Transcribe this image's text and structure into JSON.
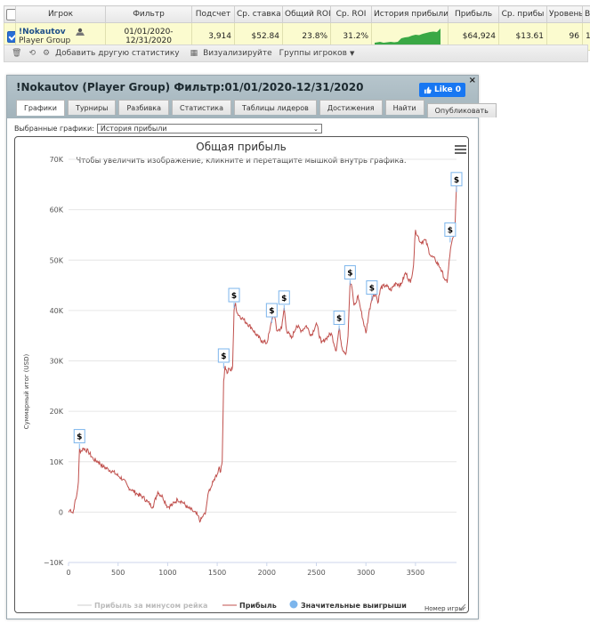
{
  "table": {
    "headers": [
      "Игрок",
      "Фильтр",
      "Подсчет",
      "Ср. ставка",
      "Общий ROI",
      "Ср. ROI",
      "История прибыли",
      "Прибыль",
      "Ср. прибы",
      "Уровень",
      "В"
    ],
    "row": {
      "player_name": "!Nokautov",
      "player_group": "Player Group",
      "filter_line1": "01/01/2020-",
      "filter_line2": "12/31/2020",
      "count": "3,914",
      "avg_stake": "$52.84",
      "total_roi": "23.8%",
      "avg_roi": "31.2%",
      "profit": "$64,924",
      "avg_profit": "$13.61",
      "level": "96",
      "extra": "1"
    }
  },
  "toolbar": {
    "add_stat": "Добавить другую статистику",
    "visualize": "Визуализируйте",
    "player_groups": "Группы игроков"
  },
  "dialog": {
    "title": "!Nokautov (Player Group) Фильтр:01/01/2020-12/31/2020",
    "like_label": "Like 0",
    "close": "×",
    "tabs": [
      "Графики",
      "Турниры",
      "Разбивка",
      "Статистика",
      "Таблицы лидеров",
      "Достижения",
      "Найти",
      "Опубликовать"
    ],
    "select_label": "Выбранные графики:",
    "select_value": "История прибыли"
  },
  "colors": {
    "profit_line": "#c0504d",
    "tab_header": "#a9b9c1",
    "fb_blue": "#1877f2",
    "sparkline": "#3aa845",
    "row_highlight": "#fbfbcf"
  },
  "chart_data": {
    "type": "line",
    "title": "Общая прибыль",
    "subtitle": "Чтобы увеличить изображение, кликните и перетащите мышкой внутрь графика.",
    "ylabel": "Суммарный итог (USD)",
    "xlabel": "Номер игры",
    "xlim": [
      0,
      3914
    ],
    "ylim": [
      -10000,
      70000
    ],
    "x_ticks": [
      "0",
      "500",
      "1000",
      "1500",
      "2000",
      "2500",
      "3000",
      "3500"
    ],
    "y_ticks": [
      "−10K",
      "0",
      "10K",
      "20K",
      "30K",
      "40K",
      "50K",
      "60K",
      "70K"
    ],
    "legend_position": "bottom",
    "series": [
      {
        "name": "Прибыль за минусом рейка",
        "hidden": true
      },
      {
        "name": "Прибыль",
        "points": [
          [
            0,
            0
          ],
          [
            20,
            500
          ],
          [
            45,
            -200
          ],
          [
            60,
            1500
          ],
          [
            80,
            3000
          ],
          [
            100,
            6000
          ],
          [
            110,
            12500
          ],
          [
            125,
            12000
          ],
          [
            150,
            12700
          ],
          [
            200,
            12000
          ],
          [
            250,
            10500
          ],
          [
            300,
            10000
          ],
          [
            350,
            9000
          ],
          [
            400,
            8500
          ],
          [
            450,
            8000
          ],
          [
            500,
            7200
          ],
          [
            550,
            6500
          ],
          [
            600,
            5000
          ],
          [
            650,
            4200
          ],
          [
            700,
            3500
          ],
          [
            750,
            3000
          ],
          [
            800,
            2000
          ],
          [
            850,
            1000
          ],
          [
            900,
            4000
          ],
          [
            950,
            3000
          ],
          [
            1000,
            1000
          ],
          [
            1050,
            1500
          ],
          [
            1100,
            2500
          ],
          [
            1150,
            2000
          ],
          [
            1200,
            900
          ],
          [
            1250,
            300
          ],
          [
            1300,
            -600
          ],
          [
            1330,
            -1800
          ],
          [
            1360,
            -600
          ],
          [
            1380,
            -400
          ],
          [
            1400,
            2500
          ],
          [
            1420,
            4500
          ],
          [
            1440,
            5000
          ],
          [
            1460,
            6000
          ],
          [
            1480,
            7000
          ],
          [
            1500,
            7500
          ],
          [
            1520,
            9000
          ],
          [
            1535,
            8000
          ],
          [
            1550,
            10000
          ],
          [
            1565,
            26000
          ],
          [
            1580,
            29000
          ],
          [
            1600,
            27500
          ],
          [
            1620,
            28500
          ],
          [
            1640,
            28000
          ],
          [
            1655,
            29000
          ],
          [
            1670,
            40000
          ],
          [
            1685,
            41500
          ],
          [
            1700,
            39500
          ],
          [
            1750,
            38500
          ],
          [
            1800,
            37500
          ],
          [
            1850,
            36500
          ],
          [
            1900,
            35000
          ],
          [
            1950,
            34000
          ],
          [
            2000,
            33500
          ],
          [
            2030,
            36000
          ],
          [
            2050,
            38000
          ],
          [
            2070,
            40000
          ],
          [
            2100,
            36000
          ],
          [
            2150,
            36500
          ],
          [
            2175,
            40500
          ],
          [
            2200,
            36000
          ],
          [
            2250,
            34500
          ],
          [
            2300,
            37000
          ],
          [
            2350,
            36000
          ],
          [
            2400,
            37000
          ],
          [
            2450,
            35000
          ],
          [
            2500,
            37500
          ],
          [
            2550,
            33500
          ],
          [
            2600,
            34500
          ],
          [
            2650,
            35500
          ],
          [
            2700,
            32000
          ],
          [
            2730,
            36500
          ],
          [
            2760,
            32500
          ],
          [
            2800,
            31500
          ],
          [
            2820,
            35000
          ],
          [
            2840,
            45500
          ],
          [
            2860,
            44500
          ],
          [
            2880,
            41000
          ],
          [
            2900,
            41500
          ],
          [
            2920,
            43000
          ],
          [
            2950,
            40000
          ],
          [
            3000,
            35500
          ],
          [
            3030,
            39500
          ],
          [
            3060,
            42500
          ],
          [
            3100,
            43500
          ],
          [
            3120,
            41500
          ],
          [
            3150,
            44500
          ],
          [
            3200,
            45000
          ],
          [
            3250,
            44000
          ],
          [
            3300,
            45500
          ],
          [
            3350,
            45000
          ],
          [
            3400,
            47500
          ],
          [
            3450,
            45500
          ],
          [
            3480,
            49000
          ],
          [
            3500,
            56000
          ],
          [
            3550,
            53500
          ],
          [
            3600,
            54000
          ],
          [
            3650,
            51000
          ],
          [
            3700,
            50000
          ],
          [
            3750,
            48500
          ],
          [
            3800,
            46000
          ],
          [
            3820,
            45500
          ],
          [
            3840,
            50000
          ],
          [
            3860,
            53000
          ],
          [
            3880,
            54500
          ],
          [
            3900,
            57000
          ],
          [
            3914,
            64924
          ]
        ]
      },
      {
        "name": "Значительные выигрыши",
        "markers": [
          [
            110,
            12500
          ],
          [
            1565,
            28500
          ],
          [
            1670,
            40500
          ],
          [
            2050,
            37500
          ],
          [
            2175,
            40000
          ],
          [
            2730,
            36000
          ],
          [
            2840,
            45000
          ],
          [
            3060,
            42000
          ],
          [
            3850,
            53500
          ],
          [
            3914,
            63500
          ]
        ]
      }
    ]
  }
}
